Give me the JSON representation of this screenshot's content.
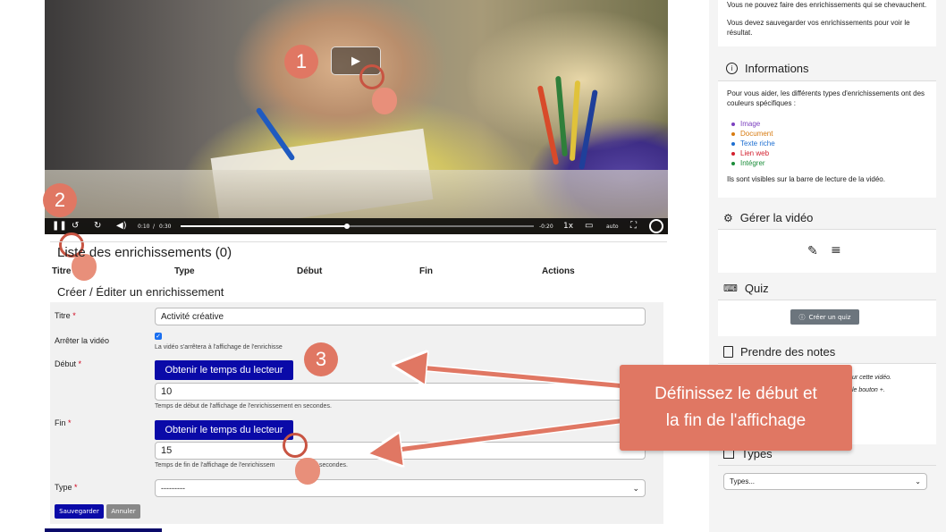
{
  "video": {
    "play_symbol": "▶",
    "controls": {
      "pause_icon": "pause-icon",
      "current_time": "0:10",
      "separator": "/",
      "duration": "0:30",
      "remaining": "-0:20",
      "speed": "1x",
      "quality": "auto",
      "progress_fraction": 0.47
    }
  },
  "badges": {
    "one": "1",
    "two": "2",
    "three": "3"
  },
  "list": {
    "title": "Liste des enrichissements (0)",
    "columns": [
      "Titre",
      "Type",
      "Début",
      "Fin",
      "Actions"
    ]
  },
  "form": {
    "title": "Créer / Éditer un enrichissement",
    "titre_label": "Titre",
    "titre_value": "Activité créative",
    "arreter_label": "Arrêter la vidéo",
    "arreter_help": "La vidéo s'arrêtera à l'affichage de l'enrichisse",
    "debut_label": "Début",
    "debut_button": "Obtenir le temps du lecteur",
    "debut_value": "10",
    "debut_help": "Temps de début de l'affichage de l'enrichissement en secondes.",
    "fin_label": "Fin",
    "fin_button": "Obtenir le temps du lecteur",
    "fin_value": "15",
    "fin_help": "Temps de fin de l'affichage de l'enrichissem",
    "fin_help_tail": "secondes.",
    "type_label": "Type",
    "type_value": "---------",
    "required_mark": "*",
    "save_label": "Sauvegarder",
    "cancel_label": "Annuler"
  },
  "sidebar": {
    "notice_1": "Vous ne pouvez faire des enrichissements qui se chevauchent.",
    "notice_2": "Vous devez sauvegarder vos enrichissements pour voir le résultat.",
    "info_title": "Informations",
    "info_text": "Pour vous aider, les différents types d'enrichissements ont des couleurs spécifiques :",
    "types": [
      {
        "label": "Image",
        "color": "#7b3fbf"
      },
      {
        "label": "Document",
        "color": "#d77b11"
      },
      {
        "label": "Texte riche",
        "color": "#1e6fd1"
      },
      {
        "label": "Lien web",
        "color": "#d3202f"
      },
      {
        "label": "Intégrer",
        "color": "#1c8d3a"
      }
    ],
    "visible_text": "Ils sont visibles sur la barre de lecture de la vidéo.",
    "manage_title": "Gérer la vidéo",
    "quiz_title": "Quiz",
    "quiz_button": "Créer un quiz",
    "notes_title": "Prendre des notes",
    "notes_frag_1": "ur cette vidéo.",
    "notes_frag_2": "le bouton +.",
    "types_title": "Types",
    "types_select": "Types..."
  },
  "callout": {
    "line1": "Définissez le début et",
    "line2": "la fin de l'affichage"
  },
  "colors": {
    "accent": "#e07763",
    "primary_button": "#0a0aa8",
    "required": "#d0021b"
  }
}
